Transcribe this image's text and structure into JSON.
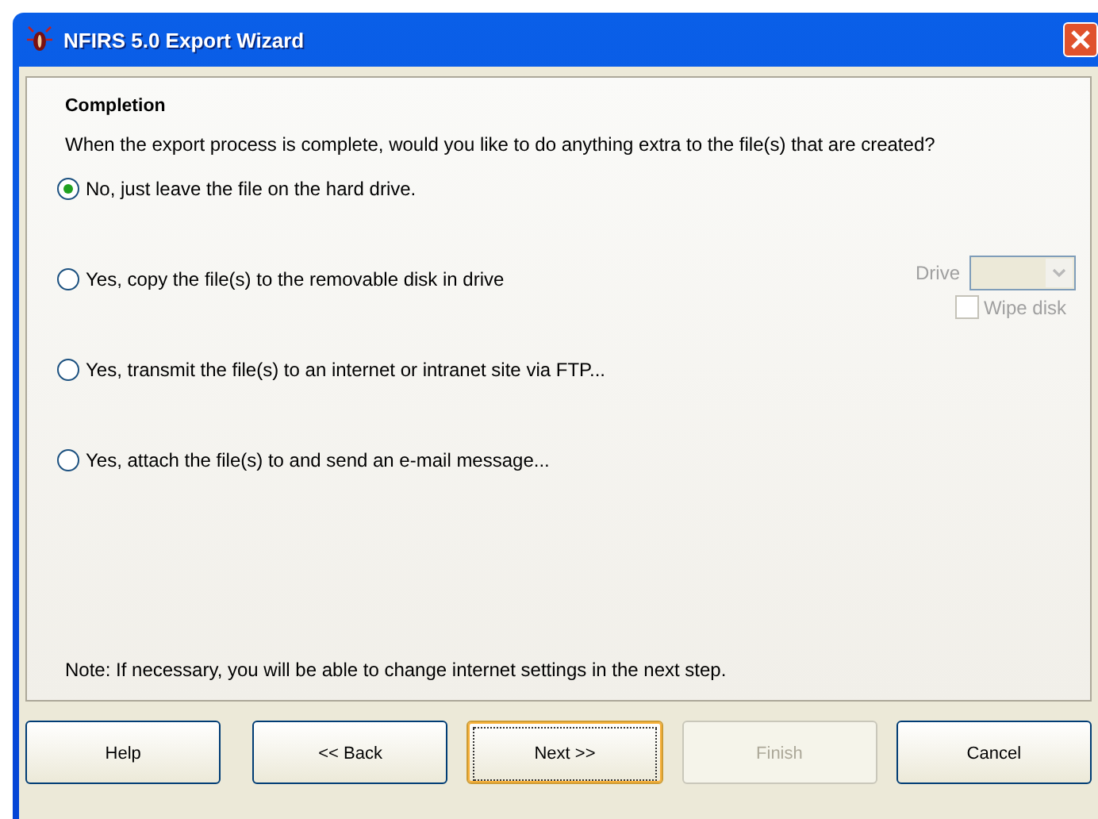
{
  "window": {
    "title": "NFIRS 5.0 Export Wizard"
  },
  "heading": "Completion",
  "question": "When the export process is complete, would you like to do anything extra to the file(s) that are created?",
  "options": [
    {
      "label": "No, just leave the file on the hard drive.",
      "selected": true
    },
    {
      "label": "Yes, copy the file(s) to the removable disk in drive",
      "selected": false
    },
    {
      "label": "Yes, transmit the file(s) to an internet or intranet site via FTP...",
      "selected": false
    },
    {
      "label": "Yes, attach the file(s) to and send an e-mail message...",
      "selected": false
    }
  ],
  "drive": {
    "label": "Drive",
    "disabled": true
  },
  "wipe_disk": {
    "label": "Wipe disk",
    "checked": false,
    "disabled": true
  },
  "note": "Note: If necessary, you will be able to change internet settings in the next step.",
  "buttons": [
    {
      "label": "Help",
      "disabled": false,
      "default": false
    },
    {
      "label": "<< Back",
      "disabled": false,
      "default": false
    },
    {
      "label": "Next >>",
      "disabled": false,
      "default": true
    },
    {
      "label": "Finish",
      "disabled": true,
      "default": false
    },
    {
      "label": "Cancel",
      "disabled": false,
      "default": false
    }
  ]
}
